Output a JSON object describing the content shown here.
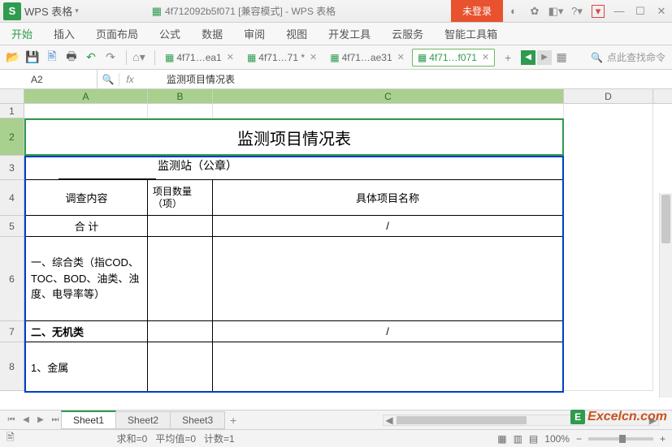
{
  "titlebar": {
    "app_name": "WPS 表格",
    "doc_title": "4f712092b5f071 [兼容模式] - WPS 表格",
    "unlogin": "未登录",
    "min": "—",
    "max": "✕"
  },
  "menu": {
    "items": [
      "开始",
      "插入",
      "页面布局",
      "公式",
      "数据",
      "审阅",
      "视图",
      "开发工具",
      "云服务",
      "智能工具箱"
    ]
  },
  "filetabs": {
    "items": [
      {
        "label": "4f71…ea1",
        "active": false,
        "close": "✕"
      },
      {
        "label": "4f71…71 *",
        "active": false,
        "close": "✕"
      },
      {
        "label": "4f71…ae31",
        "active": false,
        "close": "✕"
      },
      {
        "label": "4f71…f071",
        "active": true,
        "close": "✕"
      }
    ],
    "search_placeholder": "点此查找命令"
  },
  "formulabar": {
    "cell": "A2",
    "fx": "fx",
    "value": "监测项目情况表"
  },
  "columns": [
    "A",
    "B",
    "C",
    "D"
  ],
  "rows": [
    "1",
    "2",
    "3",
    "4",
    "5",
    "6",
    "7",
    "8"
  ],
  "sheet": {
    "title": "监测项目情况表",
    "station_label": "监测站（公章）",
    "headers": {
      "a": "调查内容",
      "b": "项目数量（项）",
      "c": "具体项目名称"
    },
    "rows": [
      {
        "a": "合  计",
        "b": "",
        "c": "/"
      },
      {
        "a": "一、综合类（指COD、TOC、BOD、油类、浊度、电导率等）",
        "b": "",
        "c": ""
      },
      {
        "a": "二、无机类",
        "b": "",
        "c": "/"
      },
      {
        "a": "1、金属",
        "b": "",
        "c": ""
      }
    ]
  },
  "sheettabs": {
    "items": [
      "Sheet1",
      "Sheet2",
      "Sheet3"
    ],
    "add": "+"
  },
  "statusbar": {
    "sum": "求和=0",
    "avg": "平均值=0",
    "count": "计数=1",
    "zoom": "100%",
    "minus": "−",
    "plus": "+"
  },
  "watermark": {
    "e": "E",
    "txt": "Excelcn.com"
  }
}
